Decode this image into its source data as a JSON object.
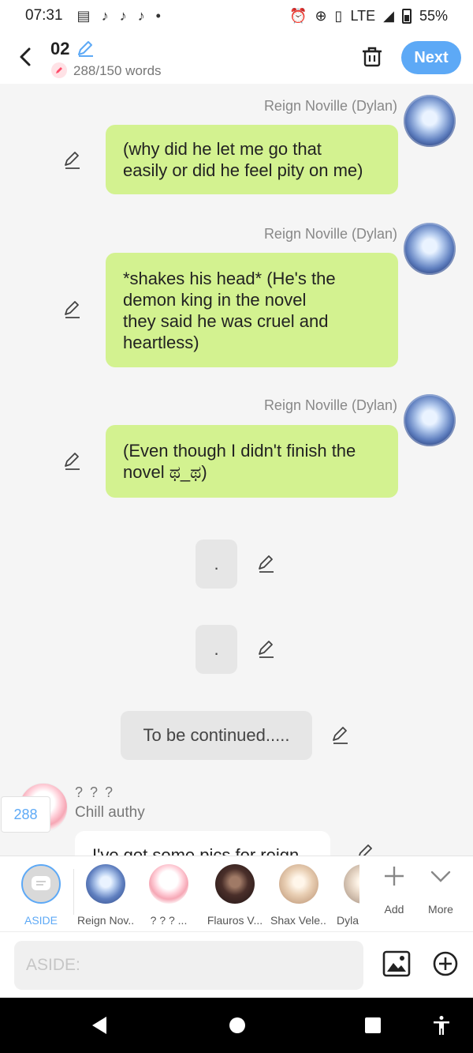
{
  "status_bar": {
    "time": "07:31",
    "network": "LTE",
    "battery": "55%"
  },
  "header": {
    "title": "02",
    "word_count": "288/150 words",
    "next_label": "Next"
  },
  "messages": [
    {
      "sender": "Reign Noville (Dylan)",
      "text": "(why did he let me go that\neasily or did he feel pity on me)"
    },
    {
      "sender": "Reign Noville (Dylan)",
      "text": "*shakes his head* (He's the\ndemon king in the novel\nthey said he was cruel and\nheartless)"
    },
    {
      "sender": "Reign Noville (Dylan)",
      "text": "(Even though I didn't finish the\nnovel ಥ_ಥ)"
    }
  ],
  "narrations": [
    ".",
    ".",
    "To be continued....."
  ],
  "partial_message": {
    "name": "? ? ?",
    "subtitle": "Chill authy",
    "text": "I've got some pics for reign",
    "badge": "288"
  },
  "characters": [
    {
      "label": "ASIDE"
    },
    {
      "label": "Reign Nov..."
    },
    {
      "label": "? ? ? ..."
    },
    {
      "label": "Flauros V..."
    },
    {
      "label": "Shax Vele..."
    },
    {
      "label": "Dyla"
    }
  ],
  "tools": {
    "add": "Add",
    "more": "More"
  },
  "input": {
    "placeholder": "ASIDE:"
  },
  "colors": {
    "accent": "#5da9f6",
    "bubble": "#d3f290"
  }
}
